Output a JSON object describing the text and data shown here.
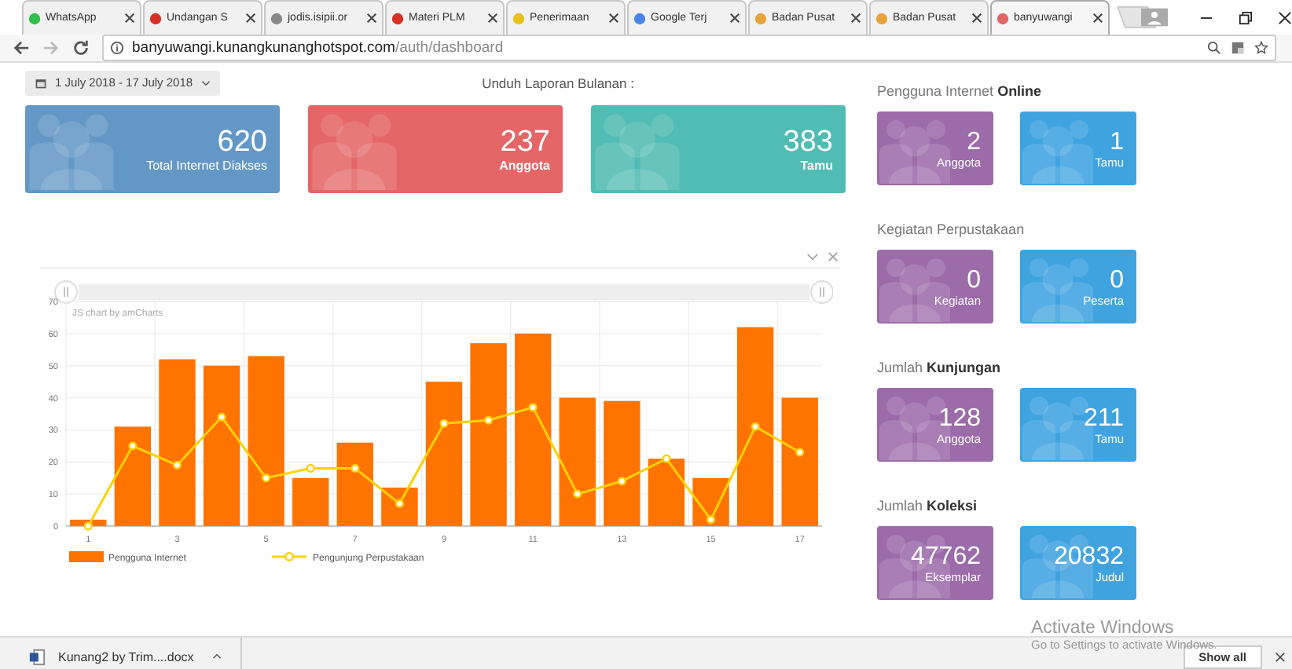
{
  "browser": {
    "tabs": [
      {
        "label": "WhatsApp",
        "selected": false
      },
      {
        "label": "Undangan S",
        "selected": false
      },
      {
        "label": "jodis.isipii.or",
        "selected": false
      },
      {
        "label": "Materi PLM",
        "selected": false
      },
      {
        "label": "Penerimaan",
        "selected": false
      },
      {
        "label": "Google Terj",
        "selected": false
      },
      {
        "label": "Badan Pusat",
        "selected": false
      },
      {
        "label": "Badan Pusat",
        "selected": false
      },
      {
        "label": "banyuwangi",
        "selected": true
      }
    ],
    "address": {
      "host": "banyuwangi.kunangkunanghotspot.com",
      "path": "/auth/dashboard"
    }
  },
  "page": {
    "date_range": "1 July 2018 - 17 July 2018",
    "report_label": "Unduh Laporan Bulanan :",
    "stats": [
      {
        "value": "620",
        "label": "Total Internet Diakses",
        "color": "#6398c6",
        "label_bold": false
      },
      {
        "value": "237",
        "label": "Anggota",
        "color": "#e46666",
        "label_bold": true
      },
      {
        "value": "383",
        "label": "Tamu",
        "color": "#50bcb3",
        "label_bold": true
      }
    ],
    "chart_panel": {
      "credit": "JS chart by amCharts",
      "chart_data": {
        "type": "bar",
        "x": [
          1,
          2,
          3,
          4,
          5,
          6,
          7,
          8,
          9,
          10,
          11,
          12,
          13,
          14,
          15,
          16,
          17
        ],
        "series": [
          {
            "name": "Pengguna Internet",
            "type": "bar",
            "color": "#ff7300",
            "values": [
              2,
              31,
              52,
              50,
              53,
              15,
              26,
              12,
              45,
              57,
              60,
              40,
              39,
              21,
              15,
              62,
              40
            ]
          },
          {
            "name": "Pengunjung Perpustakaan",
            "type": "line",
            "marker": "circle",
            "color": "#fcd202",
            "values": [
              0,
              25,
              19,
              34,
              15,
              18,
              18,
              7,
              32,
              33,
              37,
              10,
              14,
              21,
              2,
              31,
              23
            ]
          }
        ],
        "xlim": [
          0.5,
          17.5
        ],
        "ylim": [
          0,
          70
        ],
        "grid": true,
        "legend": "bottom",
        "yticks": [
          0,
          10,
          20,
          30,
          40,
          50,
          60,
          70
        ],
        "xticks": [
          1,
          3,
          5,
          7,
          9,
          11,
          13,
          15,
          17
        ]
      }
    },
    "sections": [
      {
        "title": "Pengguna Internet **Online**",
        "cards": [
          {
            "value": "2",
            "label": "Anggota",
            "color": "#9b6baa"
          },
          {
            "value": "1",
            "label": "Tamu",
            "color": "#3fa3e0"
          }
        ]
      },
      {
        "title": "Kegiatan Perpustakaan",
        "cards": [
          {
            "value": "0",
            "label": "Kegiatan",
            "color": "#9b6baa"
          },
          {
            "value": "0",
            "label": "Peserta",
            "color": "#3fa3e0"
          }
        ]
      },
      {
        "title": "Jumlah **Kunjungan**",
        "cards": [
          {
            "value": "128",
            "label": "Anggota",
            "color": "#9b6baa"
          },
          {
            "value": "211",
            "label": "Tamu",
            "color": "#3fa3e0"
          }
        ]
      },
      {
        "title": "Jumlah **Koleksi**",
        "cards": [
          {
            "value": "47762",
            "label": "Eksemplar",
            "color": "#9b6baa"
          },
          {
            "value": "20832",
            "label": "Judul",
            "color": "#3fa3e0"
          }
        ]
      }
    ]
  },
  "downloads": {
    "file": "Kunang2 by Trim....docx",
    "show_all": "Show all"
  },
  "os_overlay": {
    "title": "Activate Windows",
    "subtitle": "Go to Settings to activate Windows."
  }
}
